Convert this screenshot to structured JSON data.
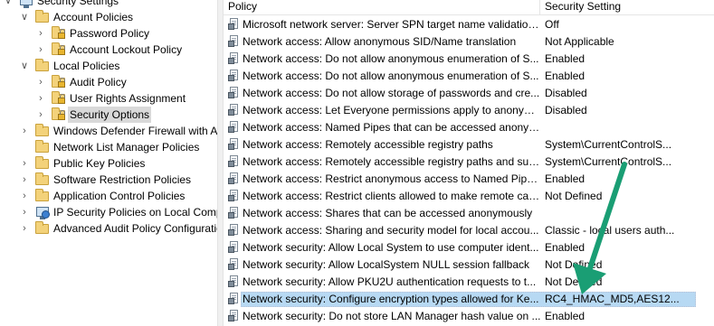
{
  "tree": {
    "items": [
      {
        "label": "Security Settings",
        "level": 0,
        "expanded": true,
        "icon": "computer-icon"
      },
      {
        "label": "Account Policies",
        "level": 1,
        "expanded": true,
        "icon": "folder-icon"
      },
      {
        "label": "Password Policy",
        "level": 2,
        "expanded": false,
        "icon": "folder-lock-icon"
      },
      {
        "label": "Account Lockout Policy",
        "level": 2,
        "expanded": false,
        "icon": "folder-lock-icon"
      },
      {
        "label": "Local Policies",
        "level": 1,
        "expanded": true,
        "icon": "folder-icon"
      },
      {
        "label": "Audit Policy",
        "level": 2,
        "expanded": false,
        "icon": "folder-lock-icon"
      },
      {
        "label": "User Rights Assignment",
        "level": 2,
        "expanded": false,
        "icon": "folder-lock-icon"
      },
      {
        "label": "Security Options",
        "level": 2,
        "expanded": false,
        "icon": "folder-lock-icon",
        "selected": true
      },
      {
        "label": "Windows Defender Firewall with Adva",
        "level": 1,
        "expanded": false,
        "icon": "folder-icon"
      },
      {
        "label": "Network List Manager Policies",
        "level": 1,
        "expanded": null,
        "icon": "folder-icon"
      },
      {
        "label": "Public Key Policies",
        "level": 1,
        "expanded": false,
        "icon": "folder-icon"
      },
      {
        "label": "Software Restriction Policies",
        "level": 1,
        "expanded": false,
        "icon": "folder-icon"
      },
      {
        "label": "Application Control Policies",
        "level": 1,
        "expanded": false,
        "icon": "folder-icon"
      },
      {
        "label": "IP Security Policies on Local Compute",
        "level": 1,
        "expanded": false,
        "icon": "ipsec-icon"
      },
      {
        "label": "Advanced Audit Policy Configuration",
        "level": 1,
        "expanded": false,
        "icon": "folder-icon"
      }
    ]
  },
  "list": {
    "columns": {
      "policy": "Policy",
      "setting": "Security Setting"
    },
    "rows": [
      {
        "policy": "Microsoft network server: Server SPN target name validation...",
        "setting": "Off"
      },
      {
        "policy": "Network access: Allow anonymous SID/Name translation",
        "setting": "Not Applicable"
      },
      {
        "policy": "Network access: Do not allow anonymous enumeration of S...",
        "setting": "Enabled"
      },
      {
        "policy": "Network access: Do not allow anonymous enumeration of S...",
        "setting": "Enabled"
      },
      {
        "policy": "Network access: Do not allow storage of passwords and cre...",
        "setting": "Disabled"
      },
      {
        "policy": "Network access: Let Everyone permissions apply to anonym...",
        "setting": "Disabled"
      },
      {
        "policy": "Network access: Named Pipes that can be accessed anonym...",
        "setting": ""
      },
      {
        "policy": "Network access: Remotely accessible registry paths",
        "setting": "System\\CurrentControlS..."
      },
      {
        "policy": "Network access: Remotely accessible registry paths and sub...",
        "setting": "System\\CurrentControlS..."
      },
      {
        "policy": "Network access: Restrict anonymous access to Named Pipes...",
        "setting": "Enabled"
      },
      {
        "policy": "Network access: Restrict clients allowed to make remote call...",
        "setting": "Not Defined"
      },
      {
        "policy": "Network access: Shares that can be accessed anonymously",
        "setting": ""
      },
      {
        "policy": "Network access: Sharing and security model for local accou...",
        "setting": "Classic - local users auth..."
      },
      {
        "policy": "Network security: Allow Local System to use computer ident...",
        "setting": "Enabled"
      },
      {
        "policy": "Network security: Allow LocalSystem NULL session fallback",
        "setting": "Not Defined"
      },
      {
        "policy": "Network security: Allow PKU2U authentication requests to t...",
        "setting": "Not Defined"
      },
      {
        "policy": "Network security: Configure encryption types allowed for Ke...",
        "setting": "RC4_HMAC_MD5,AES12...",
        "selected": true
      },
      {
        "policy": "Network security: Do not store LAN Manager hash value on ...",
        "setting": "Enabled"
      }
    ]
  },
  "annotation": {
    "arrow_color": "#1a9e74"
  }
}
